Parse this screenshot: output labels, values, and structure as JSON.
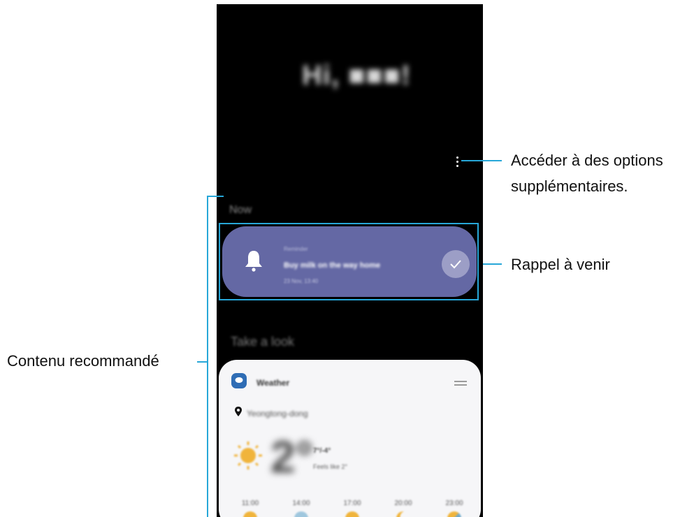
{
  "callouts": {
    "more_options_line1": "Accéder à des options",
    "more_options_line2": "supplémentaires.",
    "upcoming_reminder": "Rappel à venir",
    "recommended_content": "Contenu recommandé"
  },
  "screen": {
    "greeting": "Hi, ■■■!",
    "sections": {
      "now": "Now",
      "take_a_look": "Take a look"
    },
    "reminder": {
      "category": "Reminder",
      "title": "Buy milk on the way home",
      "time": "23 Nov, 13:40",
      "bell_icon": "bell-icon",
      "done_icon": "check-icon"
    },
    "weather": {
      "title": "Weather",
      "location": "Yeongtong-dong",
      "temperature": "2°",
      "high_low": "7°/-4°",
      "condition": "Feels like 2°",
      "hours": [
        {
          "time": "11:00",
          "icon": "sun-icon"
        },
        {
          "time": "14:00",
          "icon": "cloud-icon"
        },
        {
          "time": "17:00",
          "icon": "sun-icon"
        },
        {
          "time": "20:00",
          "icon": "moon-icon"
        },
        {
          "time": "23:00",
          "icon": "moon-cloud-icon"
        }
      ]
    }
  },
  "colors": {
    "callout_line": "#27a7d8",
    "reminder_card": "#6468a4",
    "weather_card": "#f6f6f8",
    "sun": "#f0b43c"
  }
}
